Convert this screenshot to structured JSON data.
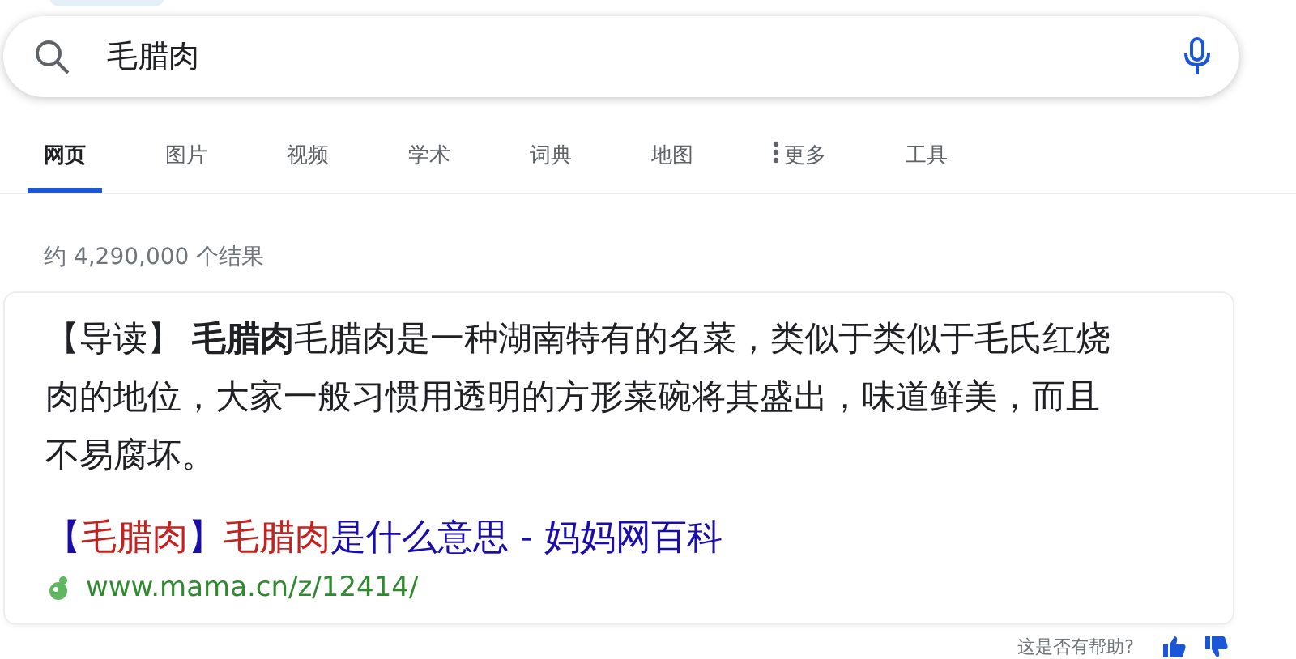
{
  "search": {
    "value": "毛腊肉"
  },
  "tabs": [
    {
      "label": "网页",
      "selected": true,
      "kind": "plain"
    },
    {
      "label": "图片",
      "selected": false,
      "kind": "plain"
    },
    {
      "label": "视频",
      "selected": false,
      "kind": "plain"
    },
    {
      "label": "学术",
      "selected": false,
      "kind": "plain"
    },
    {
      "label": "词典",
      "selected": false,
      "kind": "plain"
    },
    {
      "label": "地图",
      "selected": false,
      "kind": "plain"
    },
    {
      "label": "更多",
      "selected": false,
      "kind": "menu"
    },
    {
      "label": "工具",
      "selected": false,
      "kind": "plain"
    }
  ],
  "result_count": "约 4,290,000 个结果",
  "result": {
    "snippet": "【导读】 **毛腊肉**毛腊肉是一种湖南特有的名菜，类似于类似于毛氏红烧肉的地位，大家一般习惯用透明的方形菜碗将其盛出，味道鲜美，而且不易腐坏。",
    "title_parts": [
      {
        "text": "【",
        "highlighted": false
      },
      {
        "text": "毛腊肉",
        "highlighted": true
      },
      {
        "text": "】",
        "highlighted": false
      },
      {
        "text": "毛腊肉",
        "highlighted": true
      },
      {
        "text": "是什么意思 - 妈妈网百科",
        "highlighted": false
      }
    ],
    "url": "www.mama.cn/z/12414/"
  },
  "feedback": {
    "question": "这是否有帮助?"
  }
}
